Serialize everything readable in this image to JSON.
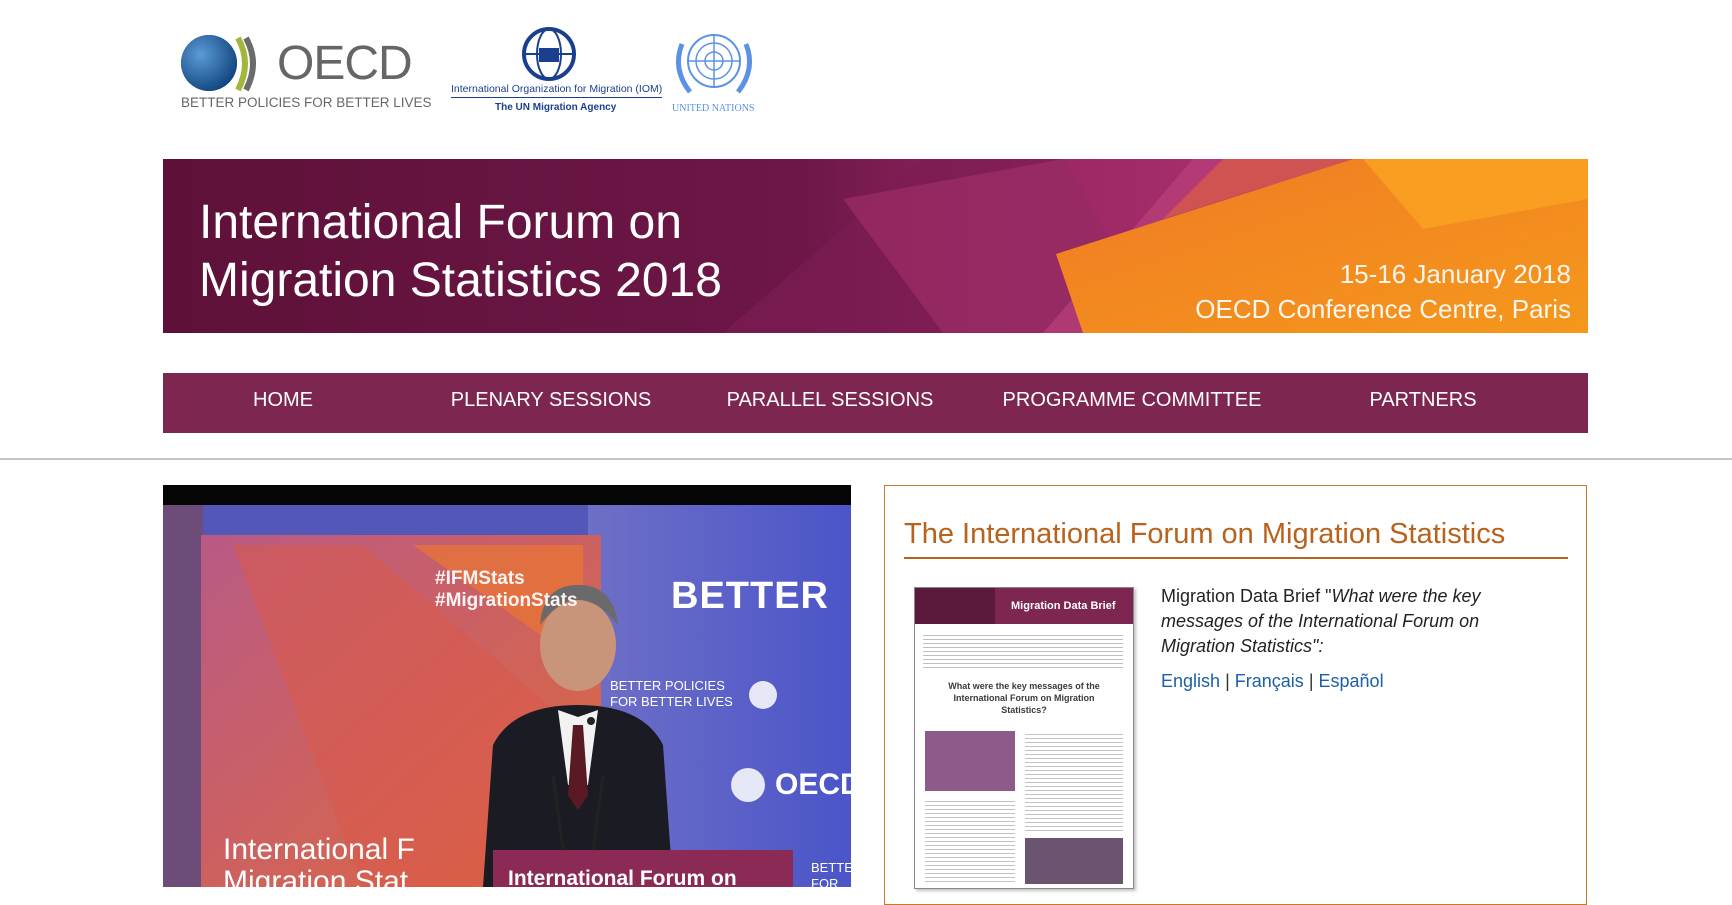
{
  "logos": {
    "oecd": {
      "name": "OECD",
      "tagline": "BETTER POLICIES FOR BETTER LIVES"
    },
    "iom": {
      "name": "International Organization for Migration (IOM)",
      "tagline": "The UN Migration Agency"
    },
    "un": {
      "name": "UNITED NATIONS"
    }
  },
  "banner": {
    "title_line1": "International Forum on",
    "title_line2": "Migration Statistics 2018",
    "date": "15-16 January 2018",
    "venue": "OECD Conference Centre, Paris"
  },
  "nav": {
    "items": [
      {
        "label": "HOME"
      },
      {
        "label": "PLENARY SESSIONS"
      },
      {
        "label": "PARALLEL SESSIONS"
      },
      {
        "label": "PROGRAMME COMMITTEE"
      },
      {
        "label": "PARTNERS"
      }
    ]
  },
  "photo": {
    "hashtag1": "#IFMStats",
    "hashtag2": "#MigrationStats",
    "backdrop_word": "BETTER",
    "backdrop_tagline1": "BETTER POLICIES",
    "backdrop_tagline2": "FOR BETTER LIVES",
    "backdrop_org": "OECD",
    "banner_text1": "International F",
    "banner_text2": "Migration Stat",
    "podium_text": "International Forum on",
    "side_text1": "BETTE",
    "side_text2": "FOR BE"
  },
  "panel": {
    "title": "The International Forum on Migration Statistics",
    "brief_prefix": "Migration Data Brief \"",
    "brief_italic": "What were the key messages of the International Forum on Migration Statistics\":",
    "thumb_header": "Migration Data Brief",
    "thumb_heading": "What were the key messages of the International Forum on Migration Statistics?",
    "links": [
      {
        "label": "English"
      },
      {
        "label": "Français"
      },
      {
        "label": "Español"
      }
    ],
    "separator": "|"
  },
  "colors": {
    "banner_dark": "#6a1445",
    "banner_orange": "#f0891d",
    "nav_bg": "#7d2650",
    "panel_accent": "#b8621b",
    "link": "#1d5fa8"
  }
}
